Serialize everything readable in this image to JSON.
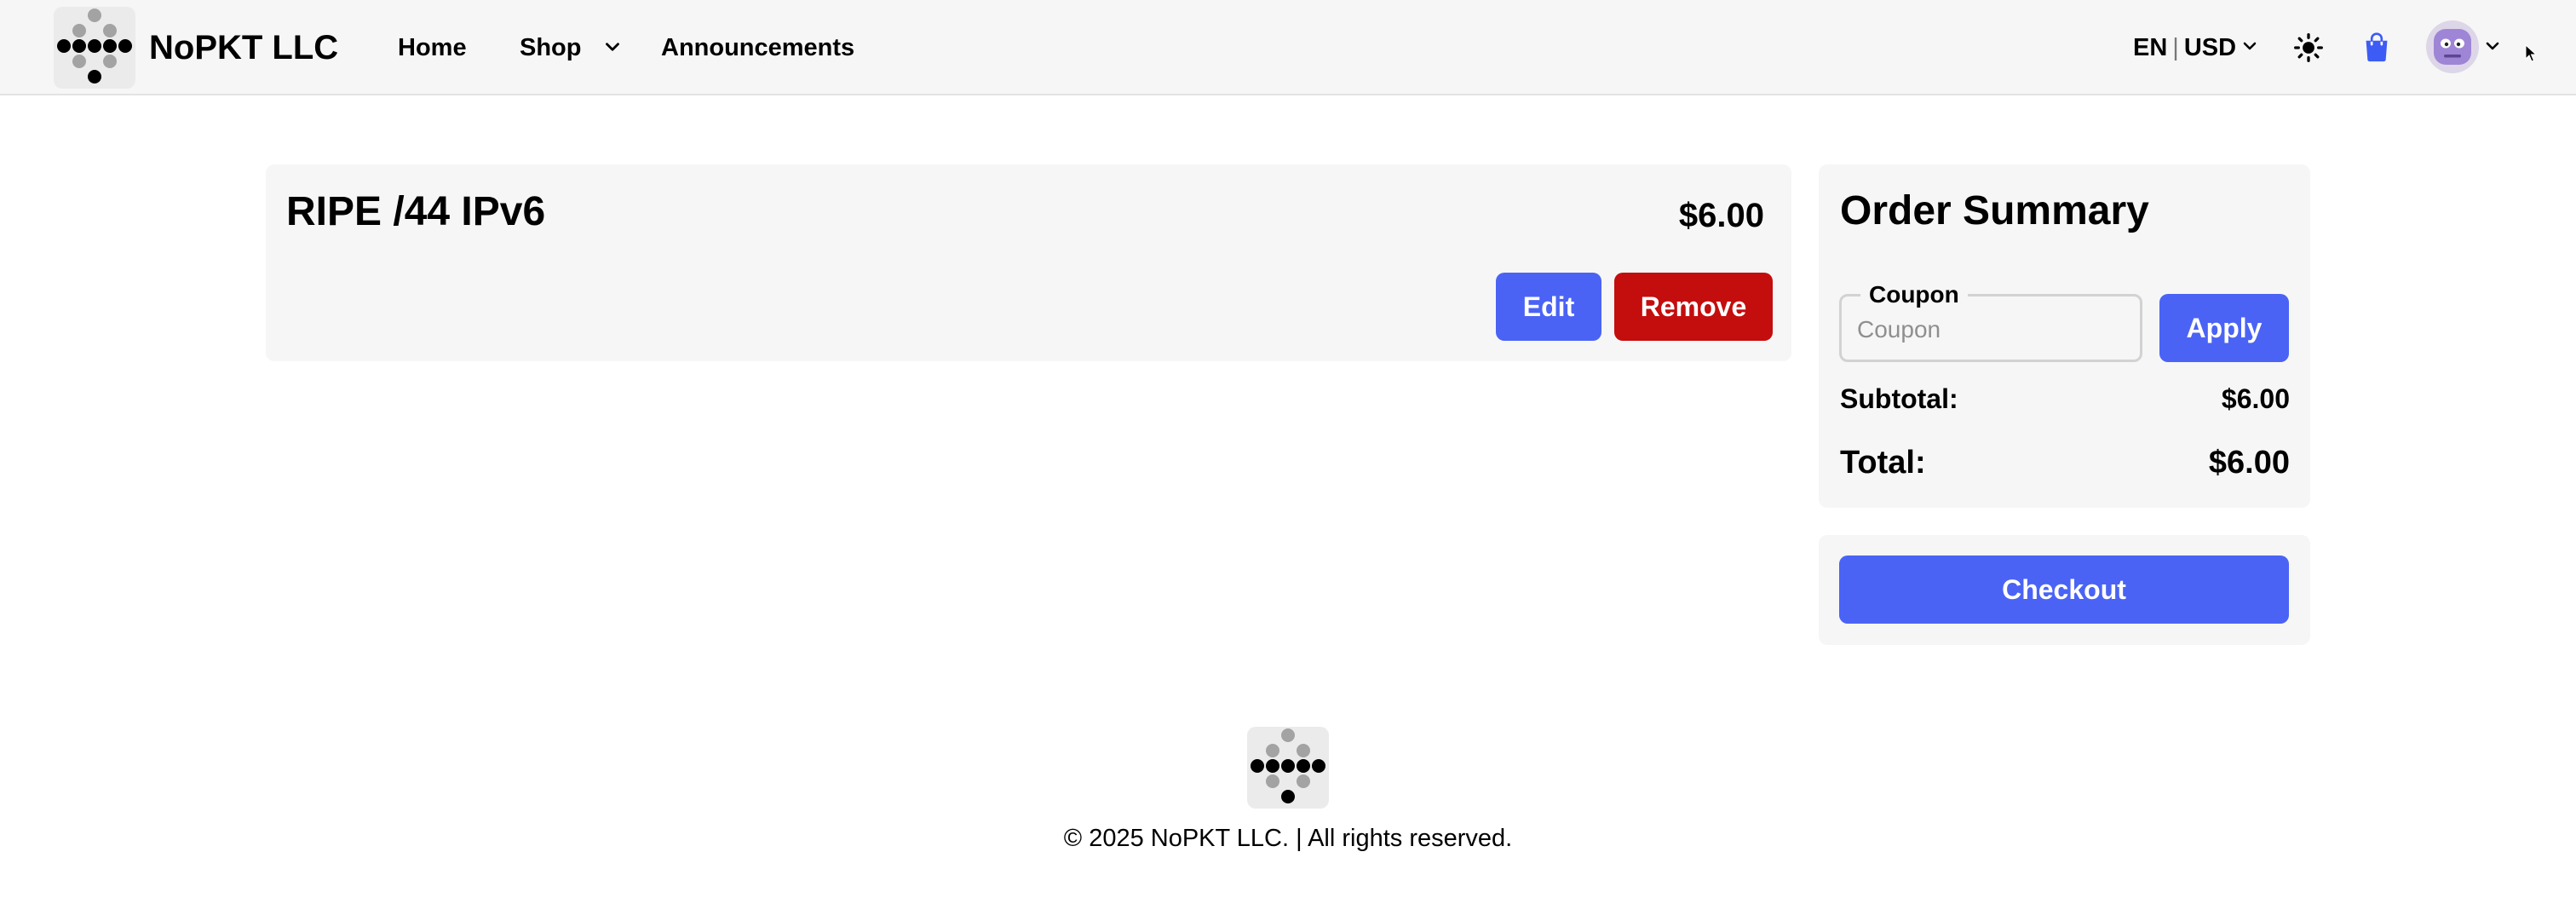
{
  "brand": {
    "name": "NoPKT LLC",
    "logo_icon": "dots-logo-icon"
  },
  "nav": {
    "home": "Home",
    "shop": "Shop",
    "announcements": "Announcements"
  },
  "header": {
    "language": "EN",
    "currency": "USD",
    "theme_icon": "sun-icon",
    "cart_icon": "shopping-bag-icon",
    "avatar_icon": "avatar-icon"
  },
  "cart": {
    "items": [
      {
        "name": "RIPE /44 IPv6",
        "price": "$6.00",
        "edit_label": "Edit",
        "remove_label": "Remove"
      }
    ]
  },
  "summary": {
    "title": "Order Summary",
    "coupon_label": "Coupon",
    "coupon_placeholder": "Coupon",
    "coupon_value": "",
    "apply_label": "Apply",
    "subtotal_label": "Subtotal:",
    "subtotal_value": "$6.00",
    "total_label": "Total:",
    "total_value": "$6.00",
    "checkout_label": "Checkout"
  },
  "footer": {
    "copyright": "© 2025 NoPKT LLC. | All rights reserved."
  },
  "colors": {
    "primary": "#4a63f5",
    "danger": "#c40d0d",
    "card_bg": "#f6f6f6",
    "header_bg": "#f6f6f6",
    "cart_icon": "#3d5cf5"
  }
}
